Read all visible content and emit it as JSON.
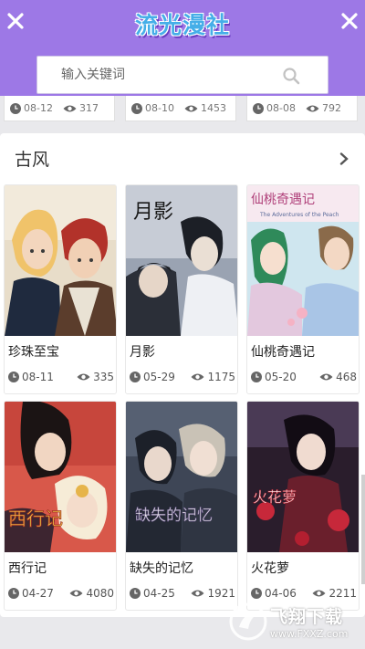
{
  "header": {
    "title": "流光漫社",
    "search_placeholder": "输入关键词",
    "bg_color": "#9d78e6"
  },
  "prev_section": {
    "cards": [
      {
        "date": "08-12",
        "views": "317"
      },
      {
        "date": "08-10",
        "views": "1453"
      },
      {
        "date": "08-08",
        "views": "792"
      }
    ]
  },
  "section": {
    "title": "古风",
    "items": [
      {
        "title": "珍珠至宝",
        "date": "08-11",
        "views": "335"
      },
      {
        "title": "月影",
        "date": "05-29",
        "views": "1175"
      },
      {
        "title": "仙桃奇遇记",
        "date": "05-20",
        "views": "468"
      },
      {
        "title": "西行记",
        "date": "04-27",
        "views": "4080"
      },
      {
        "title": "缺失的记忆",
        "date": "04-25",
        "views": "1921"
      },
      {
        "title": "火花萝",
        "date": "04-06",
        "views": "2211"
      }
    ],
    "cover_art": {
      "c1_text": "",
      "c2_text": "月影",
      "c3_text": "仙桃奇遇记",
      "c3_sub": "The Adventures of the Peach",
      "c4_text": "西行记",
      "c5_text": "缺失的记忆",
      "c6_text": "火花萝"
    }
  },
  "watermark": {
    "name": "飞翔下载",
    "url": "www.FXXZ.com"
  }
}
